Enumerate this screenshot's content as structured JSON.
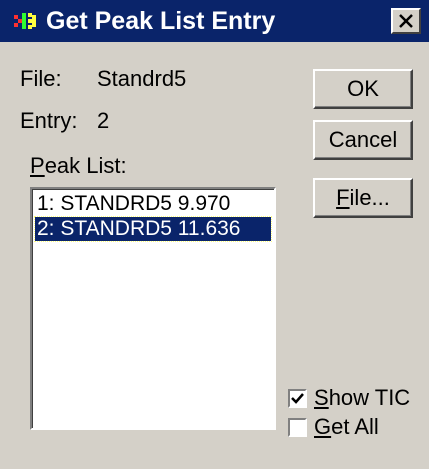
{
  "window": {
    "title": "Get Peak List Entry",
    "close_glyph": "✕"
  },
  "info": {
    "file_label": "File:",
    "file_value": "Standrd5",
    "entry_label": "Entry:",
    "entry_value": "2"
  },
  "peak_list": {
    "label_prefix": "P",
    "label_rest": "eak List:",
    "items": [
      {
        "text": "1: STANDRD5 9.970",
        "selected": false
      },
      {
        "text": "2: STANDRD5 11.636",
        "selected": true
      }
    ]
  },
  "buttons": {
    "ok": "OK",
    "cancel": "Cancel",
    "file_prefix": "F",
    "file_rest": "ile..."
  },
  "options": {
    "show_tic": {
      "prefix": "S",
      "rest": "how TIC",
      "checked": true
    },
    "get_all": {
      "prefix": "G",
      "rest": "et All",
      "checked": false
    }
  },
  "colors": {
    "title_bar": "#0a246a",
    "dialog_face": "#d4d0c8",
    "selection": "#0a246a"
  },
  "icons": {
    "app": "app-icon",
    "close": "close-icon",
    "check": "check-icon"
  }
}
